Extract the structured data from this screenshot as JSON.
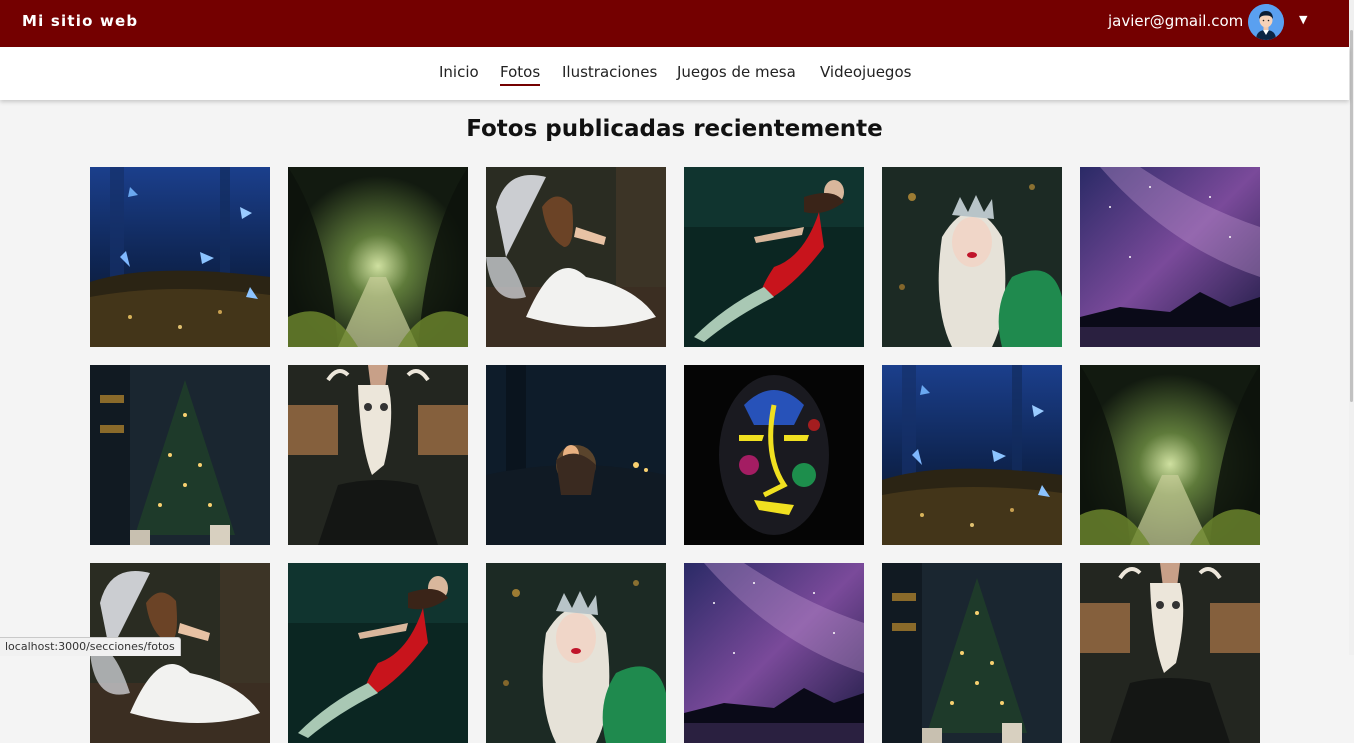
{
  "header": {
    "brand": "Mi sitio web",
    "user_email": "javier@gmail.com"
  },
  "nav": {
    "items": [
      {
        "label": "Inicio",
        "active": false
      },
      {
        "label": "Fotos",
        "active": true
      },
      {
        "label": "Ilustraciones",
        "active": false
      },
      {
        "label": "Juegos de mesa",
        "active": false
      },
      {
        "label": "Videojuegos",
        "active": false
      }
    ],
    "accent": "#740000"
  },
  "main": {
    "title": "Fotos publicadas recientemente"
  },
  "gallery": {
    "photos": [
      "blue-butterflies",
      "forest-path",
      "fairy-woman",
      "underwater-red-dress",
      "crowned-woman",
      "milky-way-lake",
      "christmas-tree",
      "skull-mask",
      "reading-by-candle",
      "neon-face-paint",
      "blue-butterflies",
      "forest-path",
      "fairy-woman",
      "underwater-red-dress",
      "crowned-woman",
      "milky-way-lake",
      "christmas-tree",
      "skull-mask"
    ]
  },
  "status_bar": {
    "url": "localhost:3000/secciones/fotos"
  },
  "colors": {
    "header_bg": "#740000",
    "page_bg": "#f4f4f4"
  }
}
